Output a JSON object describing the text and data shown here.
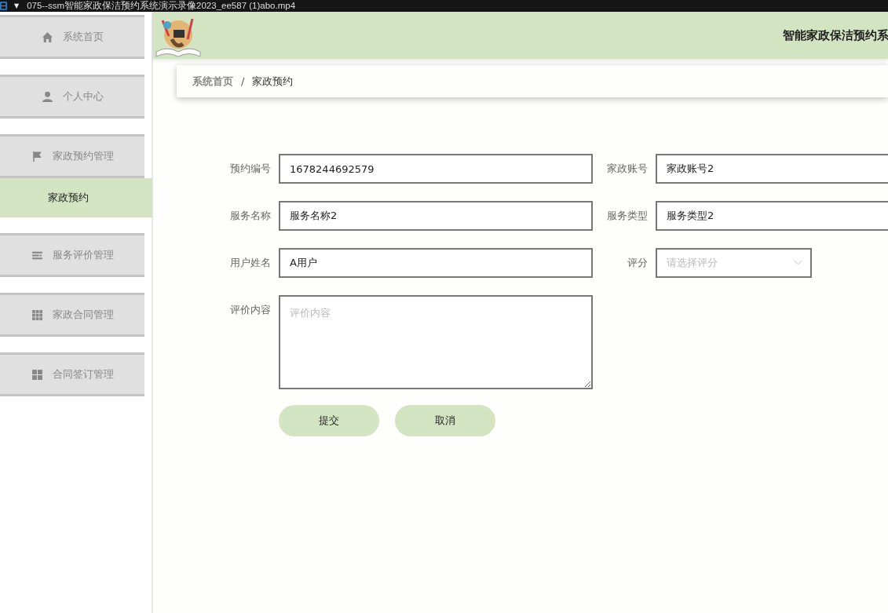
{
  "player_bar": {
    "title": "075--ssm智能家政保洁预约系统演示录像2023_ee587 (1)abo.mp4",
    "menu_glyph": "▼"
  },
  "sidebar": {
    "items": [
      {
        "label": "系统首页",
        "selected": false
      },
      {
        "label": "个人中心",
        "selected": false
      },
      {
        "label": "家政预约管理",
        "selected": false,
        "children": [
          {
            "label": "家政预约",
            "selected": true
          }
        ]
      },
      {
        "label": "服务评价管理",
        "selected": false
      },
      {
        "label": "家政合同管理",
        "selected": false
      },
      {
        "label": "合同签订管理",
        "selected": false
      }
    ]
  },
  "header": {
    "title": "智能家政保洁预约系"
  },
  "breadcrumb": [
    {
      "label": "系统首页",
      "current": false
    },
    {
      "label": "家政预约",
      "current": true
    }
  ],
  "breadcrumb_separator": "/",
  "form": {
    "left": [
      {
        "kind": "input",
        "label": "预约编号",
        "value": "1678244692579"
      },
      {
        "kind": "input",
        "label": "服务名称",
        "value": "服务名称2"
      },
      {
        "kind": "input",
        "label": "用户姓名",
        "value": "A用户"
      },
      {
        "kind": "textarea",
        "label": "评价内容",
        "placeholder": "评价内容"
      }
    ],
    "right": [
      {
        "kind": "input",
        "label": "家政账号",
        "value": "家政账号2"
      },
      {
        "kind": "input",
        "label": "服务类型",
        "value": "服务类型2"
      },
      {
        "kind": "select",
        "label": "评分",
        "placeholder": "请选择评分"
      }
    ]
  },
  "buttons": [
    "提交",
    "取消"
  ]
}
